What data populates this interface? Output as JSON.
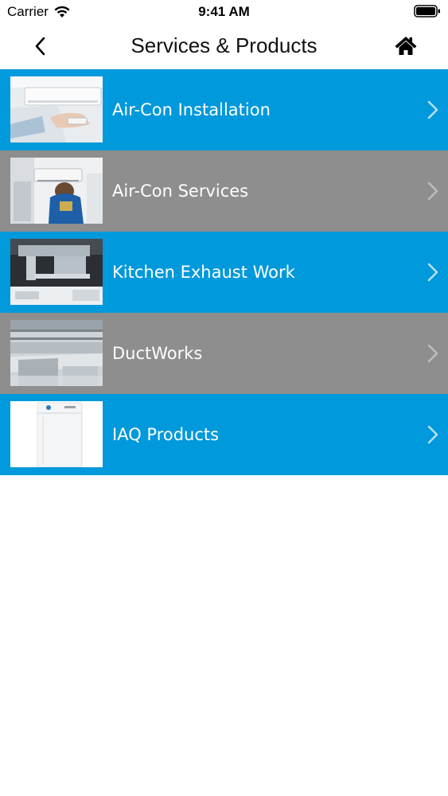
{
  "status_bar": {
    "carrier": "Carrier",
    "time": "9:41 AM"
  },
  "nav": {
    "title": "Services & Products",
    "back_icon": "chevron-left-icon",
    "home_icon": "home-icon"
  },
  "colors": {
    "blue_row": "#0099db",
    "gray_row": "#8e8e8e",
    "background": "#ffffff"
  },
  "items": [
    {
      "label": "Air-Con Installation",
      "image": "air-con-installation-photo",
      "row_color": "blue"
    },
    {
      "label": "Air-Con Services",
      "image": "air-con-services-photo",
      "row_color": "gray"
    },
    {
      "label": "Kitchen Exhaust Work",
      "image": "kitchen-exhaust-photo",
      "row_color": "blue"
    },
    {
      "label": "DuctWorks",
      "image": "ductworks-photo",
      "row_color": "gray"
    },
    {
      "label": "IAQ Products",
      "image": "iaq-products-photo",
      "row_color": "blue"
    }
  ]
}
